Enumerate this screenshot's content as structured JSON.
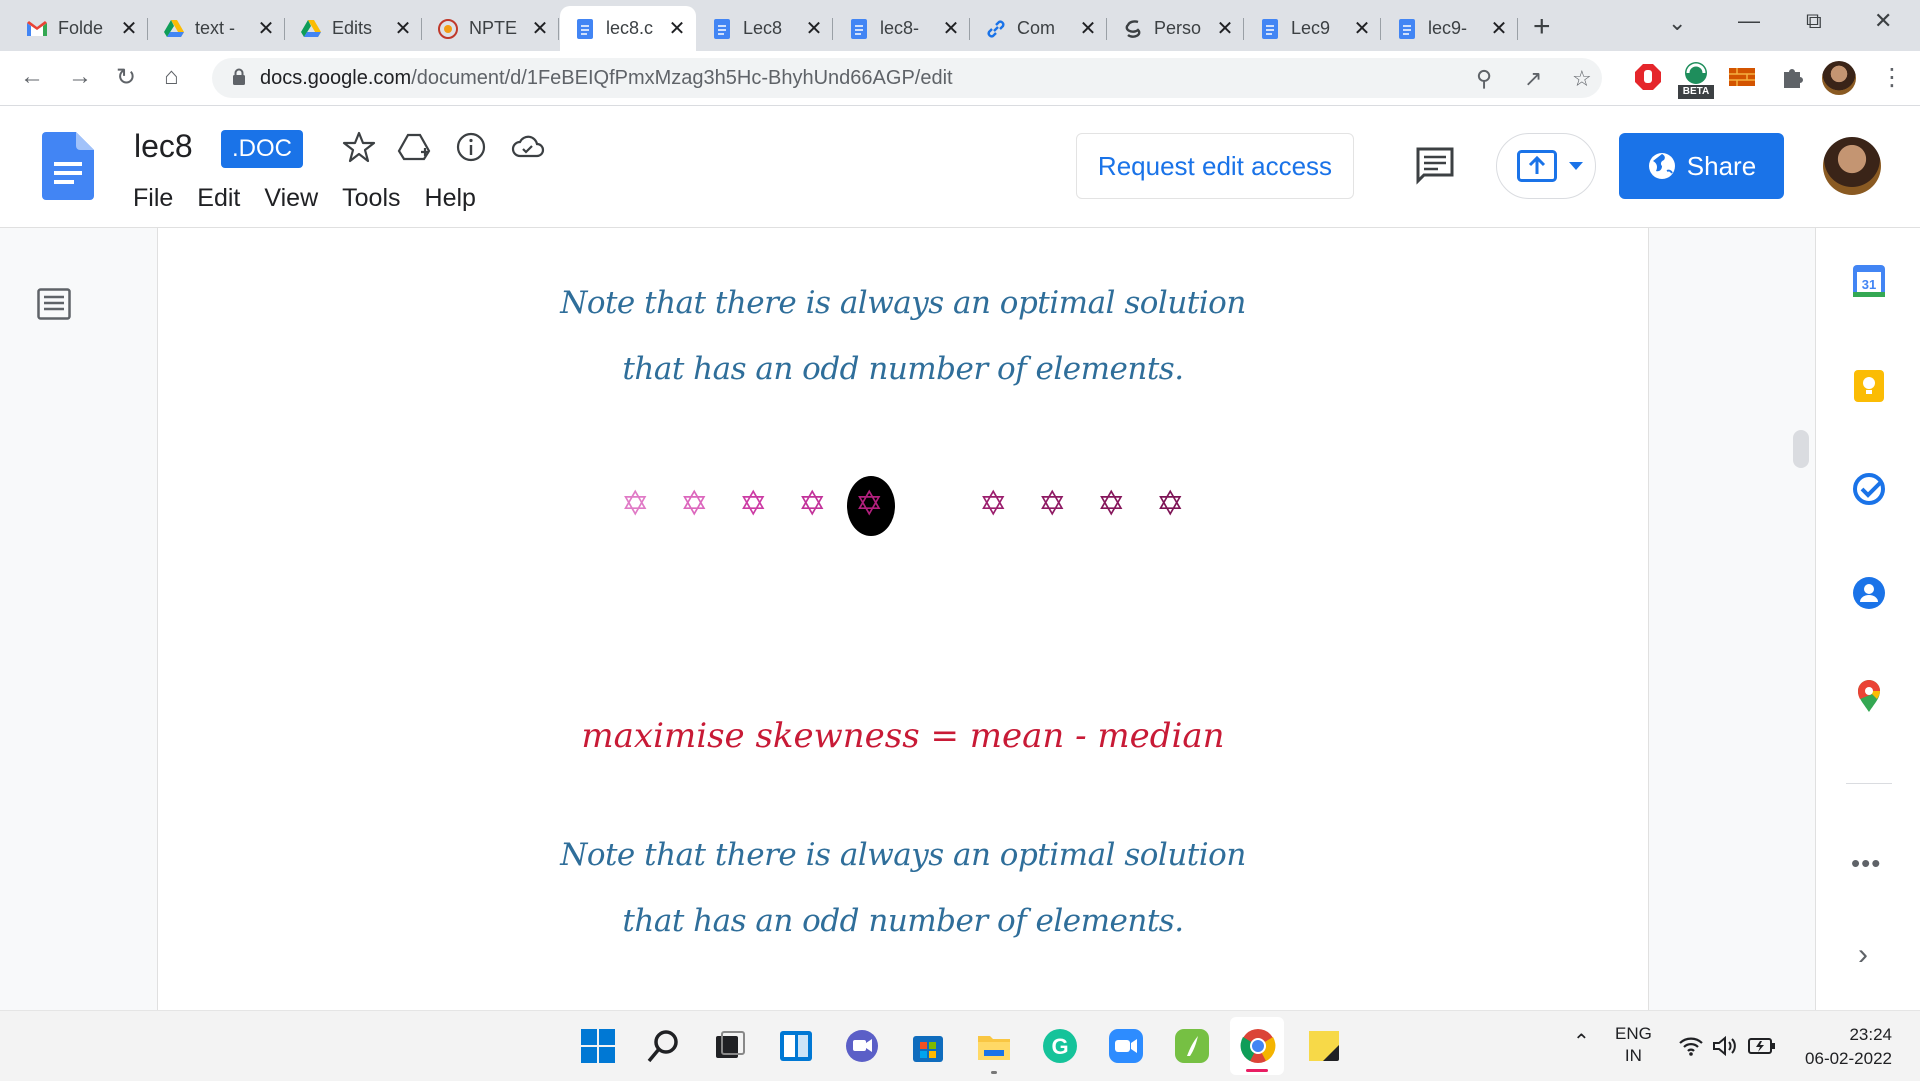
{
  "browser": {
    "tabs": [
      {
        "title": "Folde",
        "icon": "gmail-icon"
      },
      {
        "title": "text -",
        "icon": "drive-icon"
      },
      {
        "title": "Edits",
        "icon": "drive-icon"
      },
      {
        "title": "NPTE",
        "icon": "nptel-icon"
      },
      {
        "title": "lec8.c",
        "icon": "docs-icon",
        "active": true
      },
      {
        "title": "Lec8",
        "icon": "docs-icon"
      },
      {
        "title": "lec8-",
        "icon": "docs-icon"
      },
      {
        "title": "Com",
        "icon": "link-icon"
      },
      {
        "title": "Perso",
        "icon": "swirl-icon"
      },
      {
        "title": "Lec9",
        "icon": "docs-icon"
      },
      {
        "title": "lec9-",
        "icon": "docs-icon"
      }
    ],
    "address": {
      "domain": "docs.google.com",
      "path": "/document/d/1FeBEIQfPmxMzag3h5Hc-BhyhUnd66AGP/edit"
    },
    "extension_badge": "BETA"
  },
  "docs": {
    "title": "lec8",
    "badge": ".DOC",
    "menu": [
      "File",
      "Edit",
      "View",
      "Tools",
      "Help"
    ],
    "request_edit_label": "Request edit access",
    "share_label": "Share"
  },
  "content": {
    "note_line1": "Note that there is always an optimal solution",
    "note_line2": "that has an odd number of elements.",
    "formula": "maximise skewness = mean - median",
    "note2_line1": "Note that there is always an optimal solution",
    "note2_line2": "that has an odd number of elements.",
    "stars_left": [
      "#e07ac6",
      "#dc67bd",
      "#cc3ba4",
      "#c2329a"
    ],
    "star_center": "#b3207e",
    "stars_right": [
      "#9b1e6d",
      "#8e1a63",
      "#85165b",
      "#7d1355"
    ]
  },
  "taskbar": {
    "lang_top": "ENG",
    "lang_bottom": "IN",
    "time": "23:24",
    "date": "06-02-2022"
  },
  "colors": {
    "accent": "#1a73e8",
    "note_text": "#2f6e9a",
    "formula_text": "#c81a36"
  }
}
